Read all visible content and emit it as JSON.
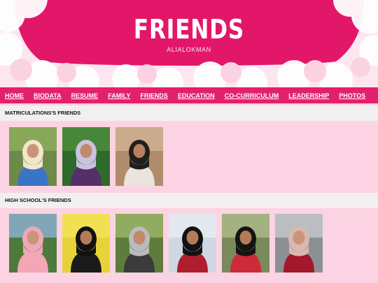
{
  "header": {
    "title": "FRIENDS",
    "subtitle": "ALIALOKMAN",
    "accent": "#e3176a",
    "cloud_color": "#fde6ef"
  },
  "nav": {
    "items": [
      {
        "label": "HOME"
      },
      {
        "label": "BIODATA"
      },
      {
        "label": "RESUME"
      },
      {
        "label": "FAMILY"
      },
      {
        "label": "FRIENDS"
      },
      {
        "label": "EDUCATION"
      },
      {
        "label": "CO-CURRICULUM"
      },
      {
        "label": "LEADERSHIP"
      },
      {
        "label": "PHOTOS"
      }
    ],
    "background": "#e3206b"
  },
  "sections": [
    {
      "title": "MATRICULATIONS'S FRIENDS",
      "photos": [
        {
          "bg": "#6d8a4a",
          "top": "#8fae5c",
          "hijab": "#f1e7c9",
          "body": "#3a74c7",
          "face": "#c99579",
          "name": "photo-matric-1"
        },
        {
          "bg": "#2f6a2d",
          "top": "#4f8f3c",
          "hijab": "#c9c3df",
          "body": "#54306b",
          "face": "#c08a6b",
          "name": "photo-matric-2"
        },
        {
          "bg": "#b08c6a",
          "top": "#d1b394",
          "hijab": "#1f1f1f",
          "body": "#e9e4dc",
          "face": "#b98060",
          "name": "photo-matric-3"
        }
      ]
    },
    {
      "title": "HIGH SCHOOL'S FRIENDS",
      "photos": [
        {
          "bg": "#4d7a3a",
          "top": "#8fb3d6",
          "hijab": "#f0a7b8",
          "body": "#f2a6b6",
          "face": "#c99579",
          "name": "photo-school-1"
        },
        {
          "bg": "#e8d23a",
          "top": "#f3e35a",
          "hijab": "#111111",
          "body": "#1a1a1a",
          "face": "#b47a5a",
          "name": "photo-school-2"
        },
        {
          "bg": "#5e7d3c",
          "top": "#9db66a",
          "hijab": "#b9bcbf",
          "body": "#3b3b3b",
          "face": "#c08a6b",
          "name": "photo-school-3"
        },
        {
          "bg": "#cfd8e2",
          "top": "#e7edf2",
          "hijab": "#121212",
          "body": "#b01d2e",
          "face": "#b47a5a",
          "name": "photo-school-4"
        },
        {
          "bg": "#7a8a5a",
          "top": "#aebc8a",
          "hijab": "#141414",
          "body": "#cf2a3a",
          "face": "#b47a5a",
          "name": "photo-school-5"
        },
        {
          "bg": "#8c8f94",
          "top": "#c7c9cc",
          "hijab": "#d9b8b0",
          "body": "#a3182a",
          "face": "#c99579",
          "name": "photo-school-6"
        }
      ]
    }
  ]
}
